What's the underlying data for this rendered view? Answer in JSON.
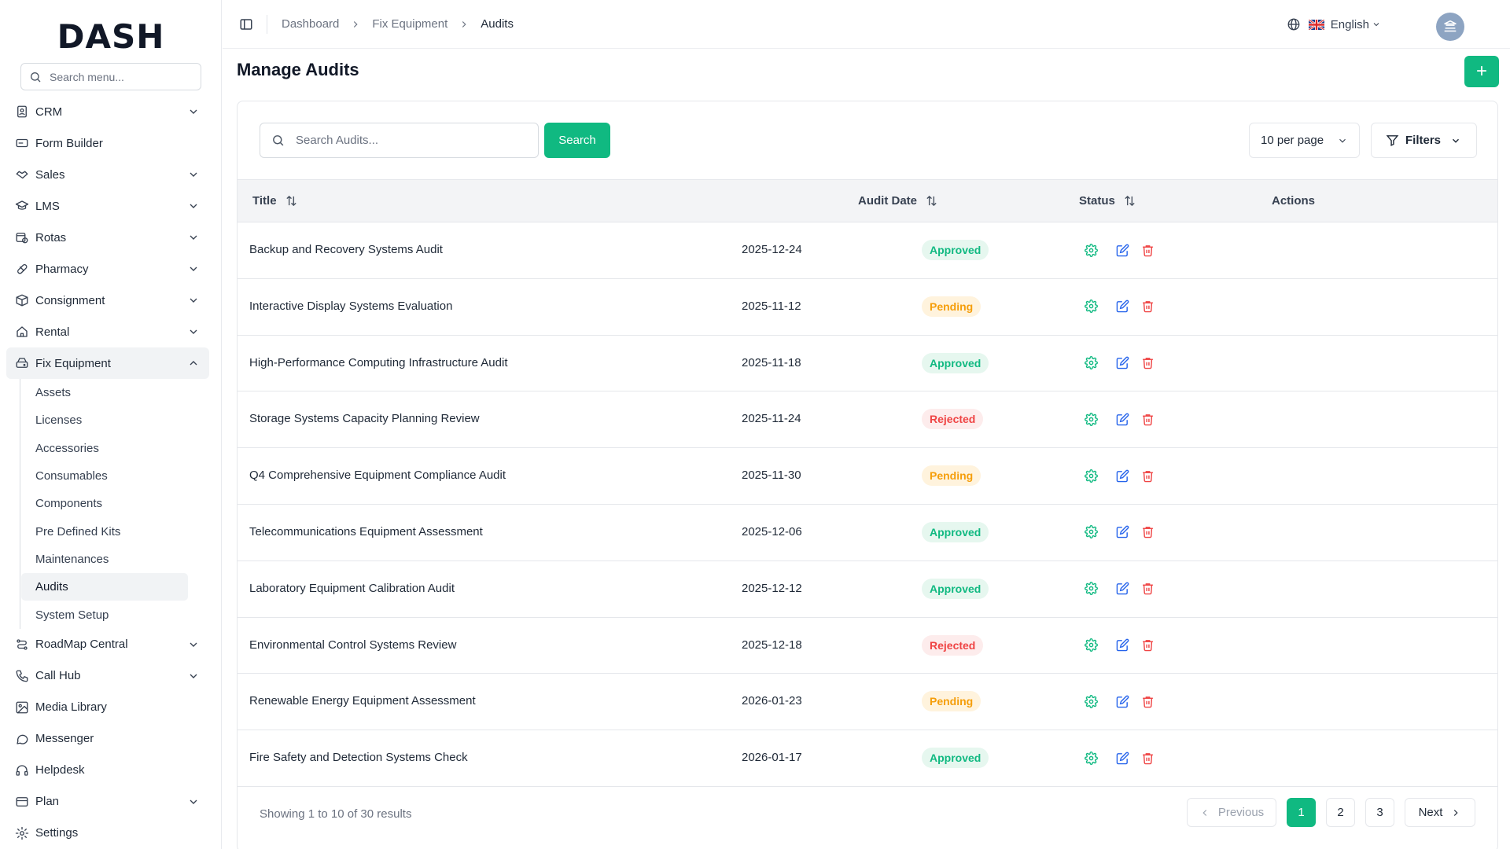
{
  "app": {
    "logo_main": "DASH"
  },
  "sidebar": {
    "search_placeholder": "Search menu...",
    "items": [
      {
        "label": "CRM",
        "icon": "contact-book-icon",
        "has_children": true
      },
      {
        "label": "Form Builder",
        "icon": "form-icon",
        "has_children": false
      },
      {
        "label": "Sales",
        "icon": "handshake-icon",
        "has_children": true
      },
      {
        "label": "LMS",
        "icon": "graduation-cap-icon",
        "has_children": true
      },
      {
        "label": "Rotas",
        "icon": "calendar-clock-icon",
        "has_children": true
      },
      {
        "label": "Pharmacy",
        "icon": "pill-icon",
        "has_children": true
      },
      {
        "label": "Consignment",
        "icon": "package-icon",
        "has_children": true
      },
      {
        "label": "Rental",
        "icon": "home-icon",
        "has_children": true
      },
      {
        "label": "Fix Equipment",
        "icon": "hard-drive-icon",
        "has_children": true,
        "open": true
      }
    ],
    "sub_items": [
      "Assets",
      "Licenses",
      "Accessories",
      "Consumables",
      "Components",
      "Pre Defined Kits",
      "Maintenances",
      "Audits",
      "System Setup"
    ],
    "active_sub": "Audits",
    "items_after": [
      {
        "label": "RoadMap Central",
        "icon": "roadmap-icon",
        "has_children": true
      },
      {
        "label": "Call Hub",
        "icon": "phone-icon",
        "has_children": true
      },
      {
        "label": "Media Library",
        "icon": "image-icon",
        "has_children": false
      },
      {
        "label": "Messenger",
        "icon": "message-icon",
        "has_children": false
      },
      {
        "label": "Helpdesk",
        "icon": "headset-icon",
        "has_children": false
      },
      {
        "label": "Plan",
        "icon": "credit-card-icon",
        "has_children": true
      },
      {
        "label": "Settings",
        "icon": "gear-icon",
        "has_children": false
      }
    ]
  },
  "header": {
    "breadcrumbs": [
      "Dashboard",
      "Fix Equipment",
      "Audits"
    ],
    "language": "English"
  },
  "page": {
    "title": "Manage Audits",
    "add_label": "+",
    "search_placeholder": "Search Audits...",
    "search_button": "Search",
    "per_page": "10 per page",
    "filters_label": "Filters"
  },
  "table": {
    "columns": {
      "title": "Title",
      "audit_date": "Audit Date",
      "status": "Status",
      "actions": "Actions"
    },
    "rows": [
      {
        "title": "Backup and Recovery Systems Audit",
        "date": "2025-12-24",
        "status": "Approved"
      },
      {
        "title": "Interactive Display Systems Evaluation",
        "date": "2025-11-12",
        "status": "Pending"
      },
      {
        "title": "High-Performance Computing Infrastructure Audit",
        "date": "2025-11-18",
        "status": "Approved"
      },
      {
        "title": "Storage Systems Capacity Planning Review",
        "date": "2025-11-24",
        "status": "Rejected"
      },
      {
        "title": "Q4 Comprehensive Equipment Compliance Audit",
        "date": "2025-11-30",
        "status": "Pending"
      },
      {
        "title": "Telecommunications Equipment Assessment",
        "date": "2025-12-06",
        "status": "Approved"
      },
      {
        "title": "Laboratory Equipment Calibration Audit",
        "date": "2025-12-12",
        "status": "Approved"
      },
      {
        "title": "Environmental Control Systems Review",
        "date": "2025-12-18",
        "status": "Rejected"
      },
      {
        "title": "Renewable Energy Equipment Assessment",
        "date": "2026-01-23",
        "status": "Pending"
      },
      {
        "title": "Fire Safety and Detection Systems Check",
        "date": "2026-01-17",
        "status": "Approved"
      }
    ]
  },
  "pagination": {
    "showing": "Showing 1 to 10 of 30 results",
    "previous": "Previous",
    "pages": [
      "1",
      "2",
      "3"
    ],
    "current": "1",
    "next": "Next"
  },
  "colors": {
    "accent": "#10b981",
    "approved": "#10b981",
    "pending": "#f59e0b",
    "rejected": "#ef4444"
  }
}
